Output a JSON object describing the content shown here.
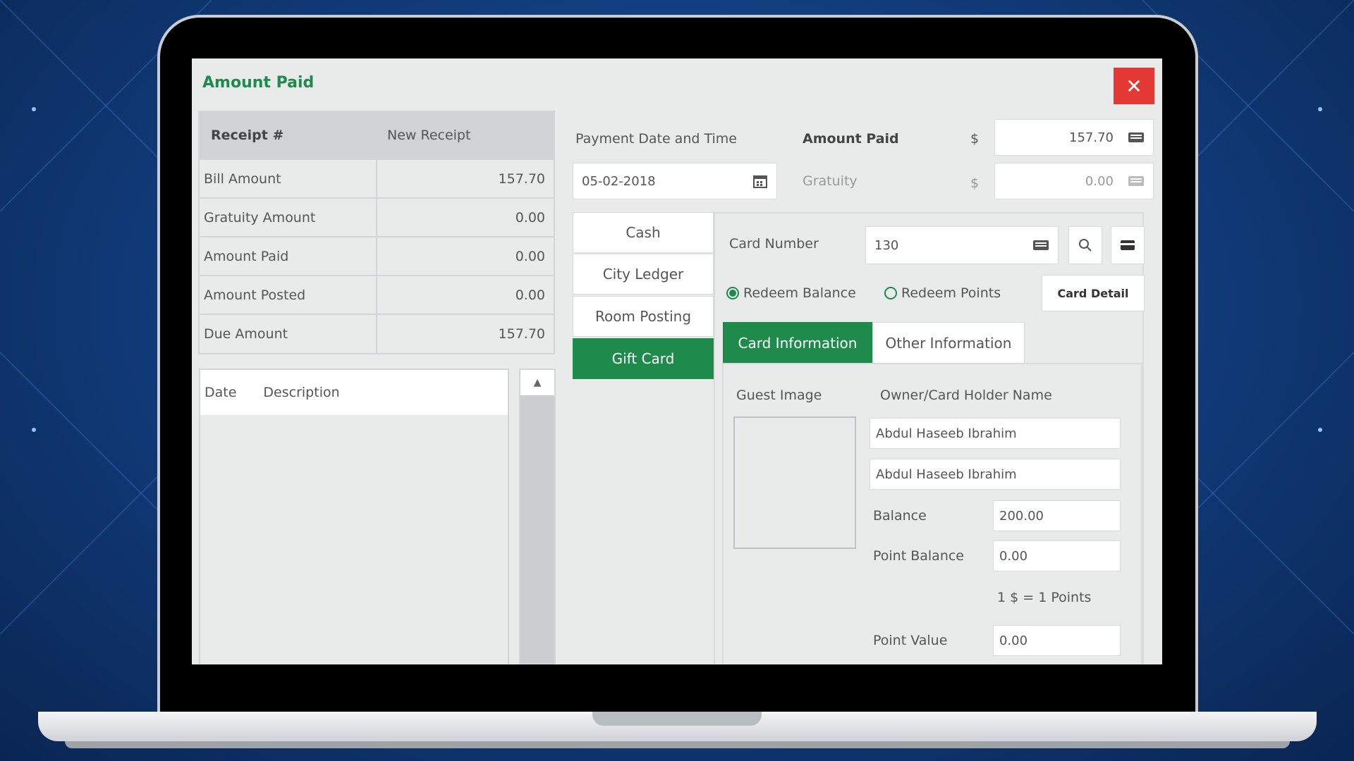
{
  "dialog": {
    "title": "Amount Paid",
    "close_icon": "close-icon"
  },
  "receipt": {
    "header_label": "Receipt #",
    "header_value": "New Receipt",
    "rows": [
      {
        "label": "Bill Amount",
        "value": "157.70"
      },
      {
        "label": "Gratuity Amount",
        "value": "0.00"
      },
      {
        "label": "Amount Paid",
        "value": "0.00"
      },
      {
        "label": "Amount Posted",
        "value": "0.00"
      },
      {
        "label": "Due Amount",
        "value": "157.70"
      }
    ]
  },
  "history": {
    "col_date": "Date",
    "col_description": "Description"
  },
  "payment": {
    "date_label": "Payment Date and Time",
    "date_value": "05-02-2018",
    "amount_label": "Amount Paid",
    "amount_currency": "$",
    "amount_value": "157.70",
    "gratuity_label": "Gratuity",
    "gratuity_currency": "$",
    "gratuity_value": "0.00"
  },
  "payment_tabs": [
    {
      "label": "Cash",
      "active": false
    },
    {
      "label": "City Ledger",
      "active": false
    },
    {
      "label": "Room Posting",
      "active": false
    },
    {
      "label": "Gift Card",
      "active": true
    }
  ],
  "gift_card": {
    "card_number_label": "Card Number",
    "card_number_value": "130",
    "redeem_balance_label": "Redeem Balance",
    "redeem_points_label": "Redeem Points",
    "selected_option": "Redeem Balance",
    "card_detail_label": "Card Detail",
    "tabs": [
      {
        "label": "Card Information",
        "active": true
      },
      {
        "label": "Other Information",
        "active": false
      }
    ],
    "guest_image_label": "Guest Image",
    "owner_label": "Owner/Card Holder Name",
    "owner_name_1": "Abdul Haseeb Ibrahim",
    "owner_name_2": "Abdul Haseeb Ibrahim",
    "balance_label": "Balance",
    "balance_value": "200.00",
    "point_balance_label": "Point Balance",
    "point_balance_value": "0.00",
    "conversion_text": "1 $ = 1 Points",
    "point_value_label": "Point Value",
    "point_value_value": "0.00"
  },
  "colors": {
    "accent_green": "#1e8a4c",
    "close_red": "#e53935",
    "background_blue": "#123f80"
  }
}
